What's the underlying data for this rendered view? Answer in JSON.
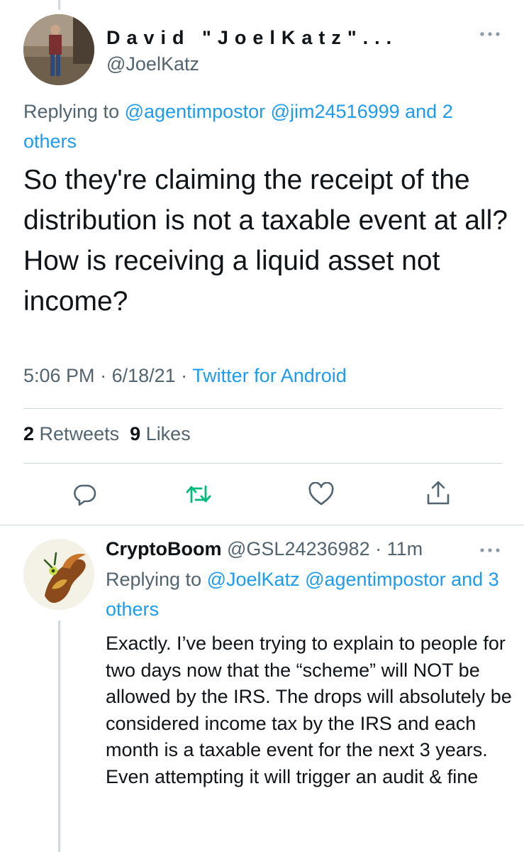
{
  "main_tweet": {
    "display_name": "David \"JoelKatz\"...",
    "handle": "@JoelKatz",
    "replying_prefix": "Replying to",
    "replying_mentions": "@agentimpostor @jim24516999 and 2 others",
    "text": "So they're claiming the receipt of the distribution is not a taxable event at all? How is receiving a liquid asset not income?",
    "time": "5:06 PM",
    "date": "6/18/21",
    "source": "Twitter for Android",
    "retweet_count": "2",
    "retweet_label": "Retweets",
    "like_count": "9",
    "like_label": "Likes"
  },
  "reply_tweet": {
    "display_name": "CryptoBoom",
    "handle": "@GSL24236982",
    "age": "11m",
    "replying_prefix": "Replying to",
    "replying_mentions": "@JoelKatz @agentimpostor and 3 others",
    "text": "Exactly. I’ve been trying to explain to people for two days now that the “scheme” will NOT be allowed by the IRS. The drops will absolutely be considered income tax by the IRS and each month is a taxable event for the next 3 years. Even attempting it will trigger an audit & fine"
  },
  "icons": {
    "more": "more-dots-icon",
    "reply": "reply-icon",
    "retweet": "retweet-icon",
    "like": "heart-icon",
    "share": "share-icon"
  },
  "colors": {
    "link": "#1d9bf0",
    "muted": "#536471",
    "retweet": "#00ba7c",
    "text": "#0f1419"
  }
}
